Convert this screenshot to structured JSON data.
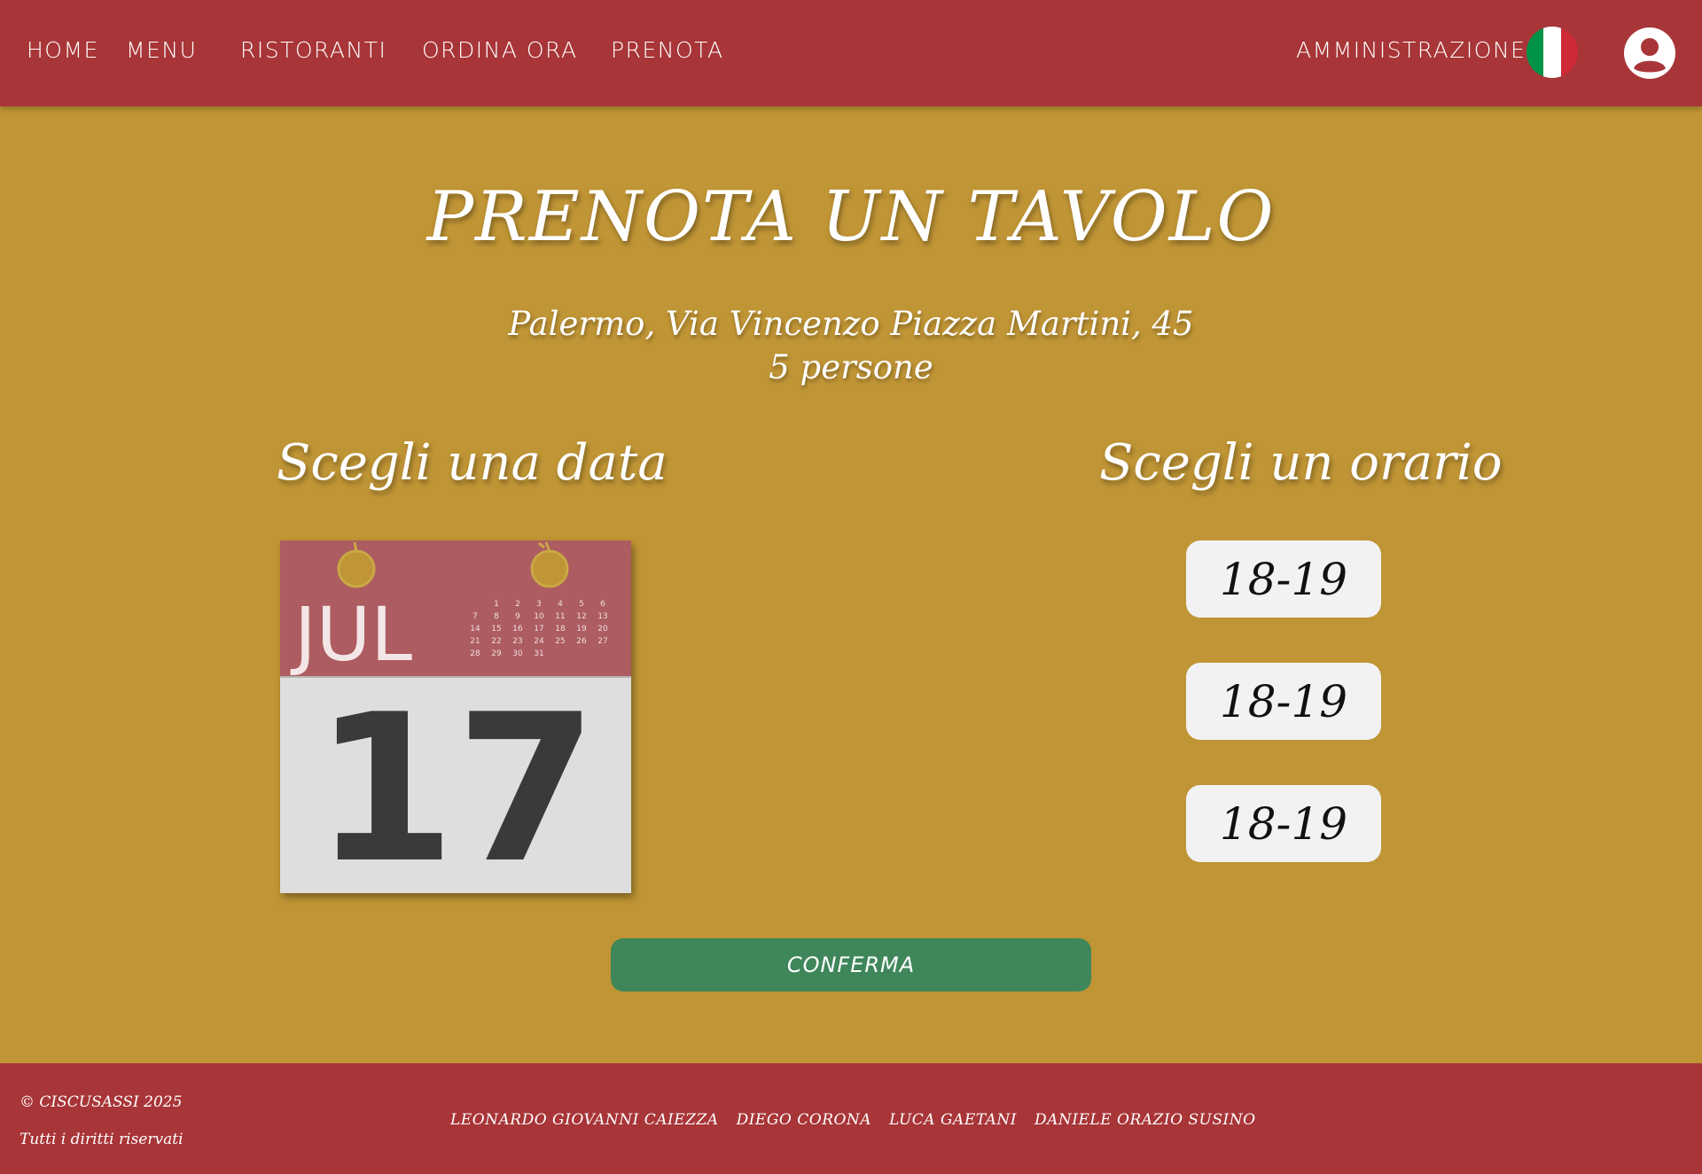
{
  "nav": {
    "home": "HOME",
    "menu": "MENU",
    "ristoranti": "RISTORANTI",
    "ordina": "ORDINA ORA",
    "prenota": "PRENOTA",
    "admin": "AMMINISTRAZIONE"
  },
  "page": {
    "title": "PRENOTA UN TAVOLO",
    "address": "Palermo, Via Vincenzo Piazza Martini, 45",
    "people": "5 persone"
  },
  "date_section": {
    "heading": "Scegli una data",
    "calendar": {
      "month": "JUL",
      "day": "17",
      "mini_days": [
        "1",
        "2",
        "3",
        "4",
        "5",
        "6",
        "7",
        "8",
        "9",
        "10",
        "11",
        "12",
        "13",
        "14",
        "15",
        "16",
        "17",
        "18",
        "19",
        "20",
        "21",
        "22",
        "23",
        "24",
        "25",
        "26",
        "27",
        "28",
        "29",
        "30",
        "31"
      ]
    }
  },
  "time_section": {
    "heading": "Scegli un orario",
    "slots": [
      "18-19",
      "18-19",
      "18-19"
    ]
  },
  "confirm_label": "CONFERMA",
  "footer": {
    "copyright": "© CISCUSASSI 2025",
    "rights": "Tutti i diritti riservati",
    "authors": [
      "LEONARDO GIOVANNI CAIEZZA",
      "DIEGO CORONA",
      "LUCA GAETANI",
      "DANIELE ORAZIO SUSINO"
    ]
  },
  "colors": {
    "nav_bg": "#a83538",
    "page_bg": "#c09535",
    "confirm_bg": "#3f875a",
    "flag_green": "#009246",
    "flag_white": "#ffffff",
    "flag_red": "#ce2b37"
  }
}
